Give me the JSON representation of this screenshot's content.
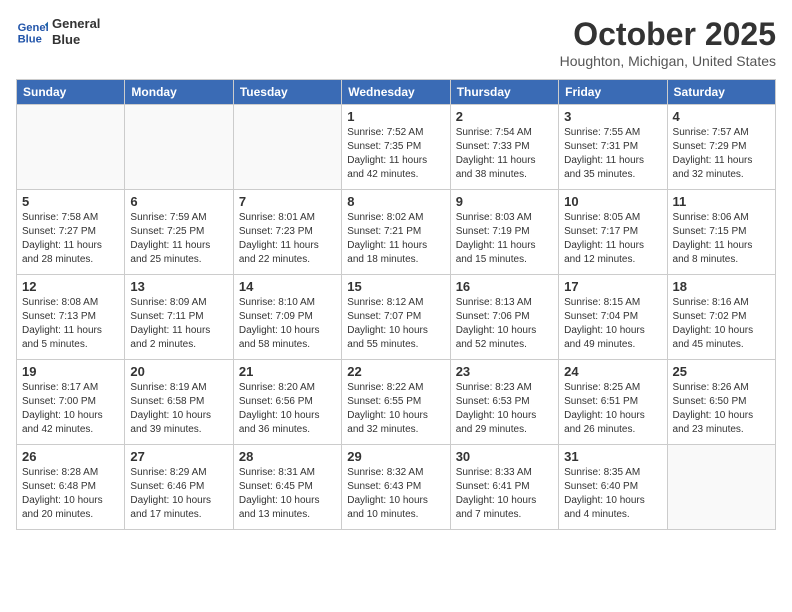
{
  "header": {
    "logo_line1": "General",
    "logo_line2": "Blue",
    "month": "October 2025",
    "location": "Houghton, Michigan, United States"
  },
  "weekdays": [
    "Sunday",
    "Monday",
    "Tuesday",
    "Wednesday",
    "Thursday",
    "Friday",
    "Saturday"
  ],
  "weeks": [
    [
      {
        "day": "",
        "info": ""
      },
      {
        "day": "",
        "info": ""
      },
      {
        "day": "",
        "info": ""
      },
      {
        "day": "1",
        "info": "Sunrise: 7:52 AM\nSunset: 7:35 PM\nDaylight: 11 hours\nand 42 minutes."
      },
      {
        "day": "2",
        "info": "Sunrise: 7:54 AM\nSunset: 7:33 PM\nDaylight: 11 hours\nand 38 minutes."
      },
      {
        "day": "3",
        "info": "Sunrise: 7:55 AM\nSunset: 7:31 PM\nDaylight: 11 hours\nand 35 minutes."
      },
      {
        "day": "4",
        "info": "Sunrise: 7:57 AM\nSunset: 7:29 PM\nDaylight: 11 hours\nand 32 minutes."
      }
    ],
    [
      {
        "day": "5",
        "info": "Sunrise: 7:58 AM\nSunset: 7:27 PM\nDaylight: 11 hours\nand 28 minutes."
      },
      {
        "day": "6",
        "info": "Sunrise: 7:59 AM\nSunset: 7:25 PM\nDaylight: 11 hours\nand 25 minutes."
      },
      {
        "day": "7",
        "info": "Sunrise: 8:01 AM\nSunset: 7:23 PM\nDaylight: 11 hours\nand 22 minutes."
      },
      {
        "day": "8",
        "info": "Sunrise: 8:02 AM\nSunset: 7:21 PM\nDaylight: 11 hours\nand 18 minutes."
      },
      {
        "day": "9",
        "info": "Sunrise: 8:03 AM\nSunset: 7:19 PM\nDaylight: 11 hours\nand 15 minutes."
      },
      {
        "day": "10",
        "info": "Sunrise: 8:05 AM\nSunset: 7:17 PM\nDaylight: 11 hours\nand 12 minutes."
      },
      {
        "day": "11",
        "info": "Sunrise: 8:06 AM\nSunset: 7:15 PM\nDaylight: 11 hours\nand 8 minutes."
      }
    ],
    [
      {
        "day": "12",
        "info": "Sunrise: 8:08 AM\nSunset: 7:13 PM\nDaylight: 11 hours\nand 5 minutes."
      },
      {
        "day": "13",
        "info": "Sunrise: 8:09 AM\nSunset: 7:11 PM\nDaylight: 11 hours\nand 2 minutes."
      },
      {
        "day": "14",
        "info": "Sunrise: 8:10 AM\nSunset: 7:09 PM\nDaylight: 10 hours\nand 58 minutes."
      },
      {
        "day": "15",
        "info": "Sunrise: 8:12 AM\nSunset: 7:07 PM\nDaylight: 10 hours\nand 55 minutes."
      },
      {
        "day": "16",
        "info": "Sunrise: 8:13 AM\nSunset: 7:06 PM\nDaylight: 10 hours\nand 52 minutes."
      },
      {
        "day": "17",
        "info": "Sunrise: 8:15 AM\nSunset: 7:04 PM\nDaylight: 10 hours\nand 49 minutes."
      },
      {
        "day": "18",
        "info": "Sunrise: 8:16 AM\nSunset: 7:02 PM\nDaylight: 10 hours\nand 45 minutes."
      }
    ],
    [
      {
        "day": "19",
        "info": "Sunrise: 8:17 AM\nSunset: 7:00 PM\nDaylight: 10 hours\nand 42 minutes."
      },
      {
        "day": "20",
        "info": "Sunrise: 8:19 AM\nSunset: 6:58 PM\nDaylight: 10 hours\nand 39 minutes."
      },
      {
        "day": "21",
        "info": "Sunrise: 8:20 AM\nSunset: 6:56 PM\nDaylight: 10 hours\nand 36 minutes."
      },
      {
        "day": "22",
        "info": "Sunrise: 8:22 AM\nSunset: 6:55 PM\nDaylight: 10 hours\nand 32 minutes."
      },
      {
        "day": "23",
        "info": "Sunrise: 8:23 AM\nSunset: 6:53 PM\nDaylight: 10 hours\nand 29 minutes."
      },
      {
        "day": "24",
        "info": "Sunrise: 8:25 AM\nSunset: 6:51 PM\nDaylight: 10 hours\nand 26 minutes."
      },
      {
        "day": "25",
        "info": "Sunrise: 8:26 AM\nSunset: 6:50 PM\nDaylight: 10 hours\nand 23 minutes."
      }
    ],
    [
      {
        "day": "26",
        "info": "Sunrise: 8:28 AM\nSunset: 6:48 PM\nDaylight: 10 hours\nand 20 minutes."
      },
      {
        "day": "27",
        "info": "Sunrise: 8:29 AM\nSunset: 6:46 PM\nDaylight: 10 hours\nand 17 minutes."
      },
      {
        "day": "28",
        "info": "Sunrise: 8:31 AM\nSunset: 6:45 PM\nDaylight: 10 hours\nand 13 minutes."
      },
      {
        "day": "29",
        "info": "Sunrise: 8:32 AM\nSunset: 6:43 PM\nDaylight: 10 hours\nand 10 minutes."
      },
      {
        "day": "30",
        "info": "Sunrise: 8:33 AM\nSunset: 6:41 PM\nDaylight: 10 hours\nand 7 minutes."
      },
      {
        "day": "31",
        "info": "Sunrise: 8:35 AM\nSunset: 6:40 PM\nDaylight: 10 hours\nand 4 minutes."
      },
      {
        "day": "",
        "info": ""
      }
    ]
  ]
}
